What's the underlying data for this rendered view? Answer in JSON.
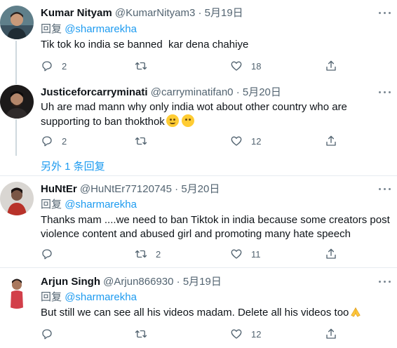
{
  "tweets": [
    {
      "name": "Kumar Nityam",
      "handle": "@KumarNityam3",
      "dot": "·",
      "date": "5月19日",
      "reply_prefix": "回复",
      "reply_to": "@sharmarekha",
      "text": "Tik tok ko india se banned  kar dena chahiye",
      "replies": "2",
      "retweets": "",
      "likes": "18"
    },
    {
      "name": "Justiceforcarryminati",
      "handle": "@carryminatifan0",
      "dot": "·",
      "date": "5月20日",
      "text": "Uh are mad mann why only india wot about other country who are supporting to ban thokthok",
      "replies": "2",
      "retweets": "",
      "likes": "12"
    },
    {
      "name": "HuNtEr",
      "handle": "@HuNtEr77120745",
      "dot": "·",
      "date": "5月20日",
      "reply_prefix": "回复",
      "reply_to": "@sharmarekha",
      "text": "Thanks mam ....we need to ban Tiktok in india because some creators post violence content and abused girl and promoting many hate speech",
      "replies": "",
      "retweets": "2",
      "likes": "11"
    },
    {
      "name": "Arjun Singh",
      "handle": "@Arjun866930",
      "dot": "·",
      "date": "5月19日",
      "reply_prefix": "回复",
      "reply_to": "@sharmarekha",
      "text": "But still we can see all his videos madam. Delete all his videos too",
      "replies": "",
      "retweets": "",
      "likes": "12"
    }
  ],
  "more_replies_label": "另外 1 条回复",
  "colors": {
    "link": "#1d9bf0",
    "secondary": "#536471",
    "divider": "#e6ecf0"
  }
}
